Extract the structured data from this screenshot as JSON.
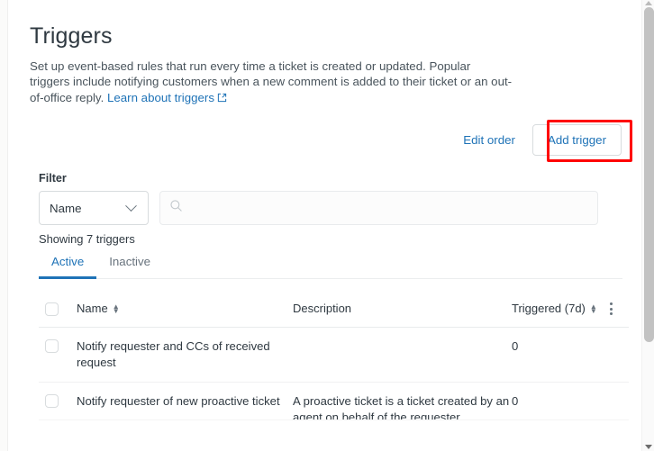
{
  "page": {
    "title": "Triggers",
    "description_part1": "Set up event-based rules that run every time a ticket is created or updated. Popular triggers include notifying customers when a new comment is added to their ticket or an out-of-office reply. ",
    "description_link": "Learn about triggers",
    "link_icon": "external-link-icon"
  },
  "actions": {
    "edit_order_label": "Edit order",
    "add_trigger_label": "Add trigger",
    "highlight_color": "#ff0000",
    "accent_color": "#1f73b7"
  },
  "filter": {
    "label": "Filter",
    "select_value": "Name",
    "select_options": [
      "Name"
    ],
    "search_value": "",
    "search_placeholder": "",
    "search_icon": "search-icon",
    "chevron_icon": "chevron-down-icon"
  },
  "results": {
    "showing_text": "Showing 7 triggers"
  },
  "tabs": [
    {
      "label": "Active",
      "active": true
    },
    {
      "label": "Inactive",
      "active": false
    }
  ],
  "table": {
    "columns": {
      "name": "Name",
      "description": "Description",
      "triggered": "Triggered (7d)"
    },
    "sort_icon": "sort-arrows-icon",
    "menu_icon": "kebab-menu-icon",
    "rows": [
      {
        "name": "Notify requester and CCs of received request",
        "description": "",
        "triggered": "0"
      },
      {
        "name": "Notify requester of new proactive ticket",
        "description": "A proactive ticket is a ticket created by an agent on behalf of the requester.",
        "triggered": "0"
      }
    ]
  },
  "scrollbar": {
    "up_arrow_icon": "scroll-up-arrow-icon",
    "down_arrow_icon": "scroll-down-arrow-icon"
  }
}
